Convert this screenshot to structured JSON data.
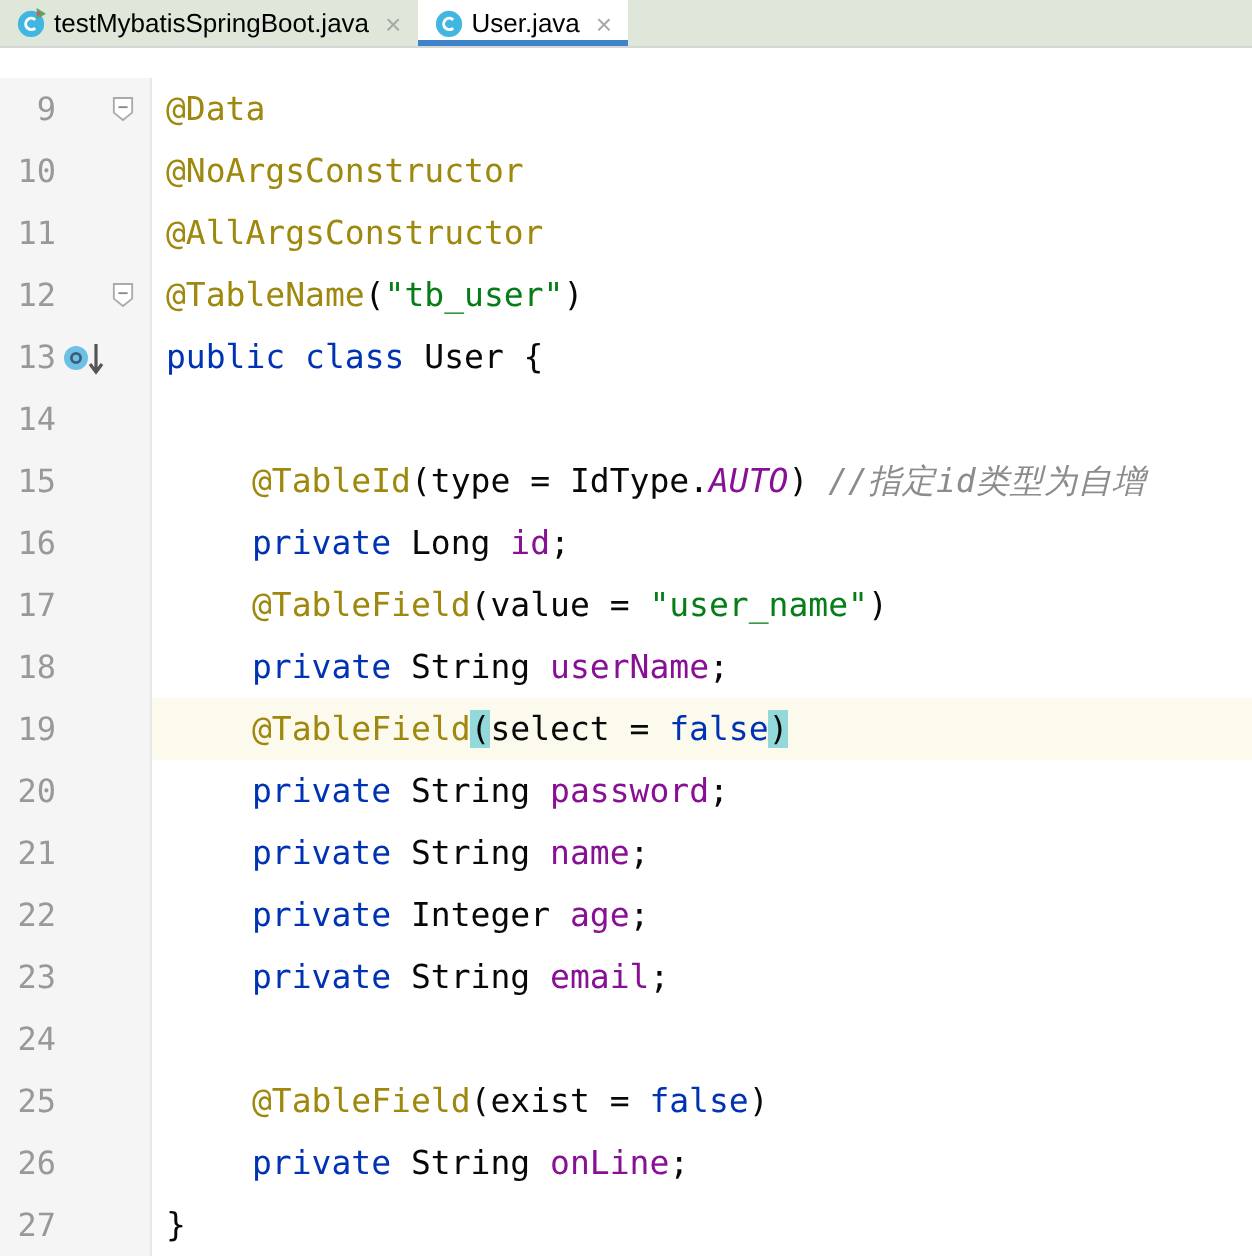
{
  "tabs": [
    {
      "label": "testMybatisSpringBoot.java",
      "selected": false,
      "close": "×",
      "kind": "runnable"
    },
    {
      "label": "User.java",
      "selected": true,
      "close": "×",
      "kind": "class"
    }
  ],
  "lines": [
    {
      "number": "9",
      "highlighted": false,
      "fold": true,
      "indented": false,
      "tokens": [
        {
          "kind": "annotation",
          "text": "@Data"
        }
      ]
    },
    {
      "number": "10",
      "highlighted": false,
      "fold": false,
      "indented": false,
      "tokens": [
        {
          "kind": "annotation",
          "text": "@NoArgsConstructor"
        }
      ]
    },
    {
      "number": "11",
      "highlighted": false,
      "fold": false,
      "indented": false,
      "tokens": [
        {
          "kind": "annotation",
          "text": "@AllArgsConstructor"
        }
      ]
    },
    {
      "number": "12",
      "highlighted": false,
      "fold": true,
      "indented": false,
      "tokens": [
        {
          "kind": "annotation",
          "text": "@TableName"
        },
        {
          "kind": "plain",
          "text": "("
        },
        {
          "kind": "string",
          "text": "\"tb_user\""
        },
        {
          "kind": "plain",
          "text": ")"
        }
      ]
    },
    {
      "number": "13",
      "highlighted": false,
      "fold": false,
      "implemented": true,
      "indented": false,
      "tokens": [
        {
          "kind": "keyword",
          "text": "public class "
        },
        {
          "kind": "plain",
          "text": "User {"
        }
      ]
    },
    {
      "number": "14",
      "highlighted": false,
      "fold": false
    },
    {
      "number": "15",
      "highlighted": false,
      "fold": false,
      "indented": true,
      "tokens": [
        {
          "kind": "annotation",
          "text": "@TableId"
        },
        {
          "kind": "plain",
          "text": "(type = IdType."
        },
        {
          "kind": "constant",
          "text": "AUTO"
        },
        {
          "kind": "plain",
          "text": ") "
        },
        {
          "kind": "comment",
          "text": "//指定id类型为自增"
        }
      ]
    },
    {
      "number": "16",
      "highlighted": false,
      "fold": false,
      "indented": true,
      "tokens": [
        {
          "kind": "keyword",
          "text": "private "
        },
        {
          "kind": "plain",
          "text": "Long "
        },
        {
          "kind": "field",
          "text": "id"
        },
        {
          "kind": "plain",
          "text": ";"
        }
      ]
    },
    {
      "number": "17",
      "highlighted": false,
      "fold": false,
      "indented": true,
      "tokens": [
        {
          "kind": "annotation",
          "text": "@TableField"
        },
        {
          "kind": "plain",
          "text": "(value = "
        },
        {
          "kind": "string",
          "text": "\"user_name\""
        },
        {
          "kind": "plain",
          "text": ")"
        }
      ]
    },
    {
      "number": "18",
      "highlighted": false,
      "fold": false,
      "indented": true,
      "tokens": [
        {
          "kind": "keyword",
          "text": "private "
        },
        {
          "kind": "plain",
          "text": "String "
        },
        {
          "kind": "field",
          "text": "userName"
        },
        {
          "kind": "plain",
          "text": ";"
        }
      ]
    },
    {
      "number": "19",
      "highlighted": true,
      "fold": false,
      "indented": true,
      "tokens": [
        {
          "kind": "annotation",
          "text": "@TableField"
        },
        {
          "kind": "brace",
          "text": "("
        },
        {
          "kind": "plain",
          "text": "select = "
        },
        {
          "kind": "keyword",
          "text": "false"
        },
        {
          "kind": "brace",
          "text": ")"
        }
      ]
    },
    {
      "number": "20",
      "highlighted": false,
      "fold": false,
      "indented": true,
      "tokens": [
        {
          "kind": "keyword",
          "text": "private "
        },
        {
          "kind": "plain",
          "text": "String "
        },
        {
          "kind": "field",
          "text": "password"
        },
        {
          "kind": "plain",
          "text": ";"
        }
      ]
    },
    {
      "number": "21",
      "highlighted": false,
      "fold": false,
      "indented": true,
      "tokens": [
        {
          "kind": "keyword",
          "text": "private "
        },
        {
          "kind": "plain",
          "text": "String "
        },
        {
          "kind": "field",
          "text": "name"
        },
        {
          "kind": "plain",
          "text": ";"
        }
      ]
    },
    {
      "number": "22",
      "highlighted": false,
      "fold": false,
      "indented": true,
      "tokens": [
        {
          "kind": "keyword",
          "text": "private "
        },
        {
          "kind": "plain",
          "text": "Integer "
        },
        {
          "kind": "field",
          "text": "age"
        },
        {
          "kind": "plain",
          "text": ";"
        }
      ]
    },
    {
      "number": "23",
      "highlighted": false,
      "fold": false,
      "indented": true,
      "tokens": [
        {
          "kind": "keyword",
          "text": "private "
        },
        {
          "kind": "plain",
          "text": "String "
        },
        {
          "kind": "field",
          "text": "email"
        },
        {
          "kind": "plain",
          "text": ";"
        }
      ]
    },
    {
      "number": "24",
      "highlighted": false,
      "fold": false
    },
    {
      "number": "25",
      "highlighted": false,
      "fold": false,
      "indented": true,
      "tokens": [
        {
          "kind": "annotation",
          "text": "@TableField"
        },
        {
          "kind": "plain",
          "text": "(exist = "
        },
        {
          "kind": "keyword",
          "text": "false"
        },
        {
          "kind": "plain",
          "text": ")"
        }
      ]
    },
    {
      "number": "26",
      "highlighted": false,
      "fold": false,
      "indented": true,
      "tokens": [
        {
          "kind": "keyword",
          "text": "private "
        },
        {
          "kind": "plain",
          "text": "String "
        },
        {
          "kind": "field",
          "text": "onLine"
        },
        {
          "kind": "plain",
          "text": ";"
        }
      ]
    },
    {
      "number": "27",
      "highlighted": false,
      "fold": false,
      "indented": false,
      "tokens": [
        {
          "kind": "plain",
          "text": "}"
        }
      ]
    }
  ]
}
